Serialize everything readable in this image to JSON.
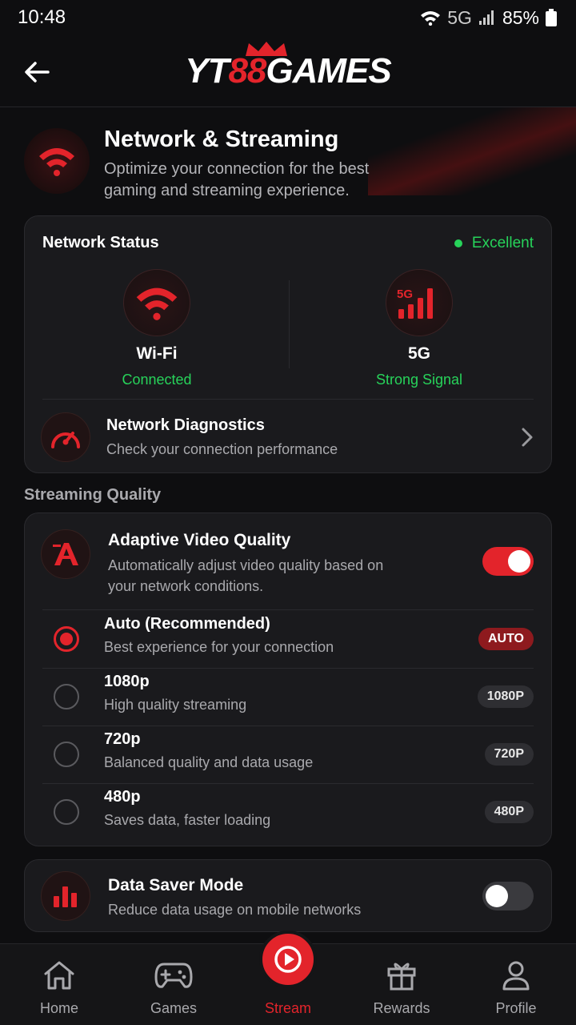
{
  "status_bar": {
    "time": "10:48",
    "network": "5G",
    "battery": "85%"
  },
  "header": {
    "logo_left": "YT",
    "logo_mid": "88",
    "logo_right": "GAMES"
  },
  "intro": {
    "title": "Network & Streaming",
    "description": "Optimize your connection for the best gaming and streaming experience."
  },
  "network_status": {
    "title": "Network Status",
    "status": "Excellent",
    "wifi": {
      "name": "Wi-Fi",
      "state": "Connected"
    },
    "cellular": {
      "name": "5G",
      "state": "Strong Signal",
      "icon_label": "5G"
    },
    "diagnostics": {
      "title": "Network Diagnostics",
      "subtitle": "Check your connection performance"
    }
  },
  "streaming_quality": {
    "section_label": "Streaming Quality",
    "adaptive": {
      "title": "Adaptive Video Quality",
      "description": "Automatically adjust video quality based on your network conditions.",
      "enabled": true
    },
    "options": [
      {
        "title": "Auto (Recommended)",
        "desc": "Best experience for your connection",
        "badge": "AUTO",
        "selected": true
      },
      {
        "title": "1080p",
        "desc": "High quality streaming",
        "badge": "1080P",
        "selected": false
      },
      {
        "title": "720p",
        "desc": "Balanced quality and data usage",
        "badge": "720P",
        "selected": false
      },
      {
        "title": "480p",
        "desc": "Saves data, faster loading",
        "badge": "480P",
        "selected": false
      }
    ]
  },
  "data_saver": {
    "title": "Data Saver Mode",
    "description": "Reduce data usage on mobile networks",
    "enabled": false
  },
  "bottom_nav": [
    {
      "label": "Home",
      "icon": "home-icon"
    },
    {
      "label": "Games",
      "icon": "gamepad-icon"
    },
    {
      "label": "Stream",
      "icon": "play-icon",
      "active": true
    },
    {
      "label": "Rewards",
      "icon": "gift-icon"
    },
    {
      "label": "Profile",
      "icon": "person-icon"
    }
  ],
  "colors": {
    "accent": "#e3242b",
    "success": "#27d35a",
    "background": "#0e0e10",
    "card": "#1a1a1d"
  }
}
